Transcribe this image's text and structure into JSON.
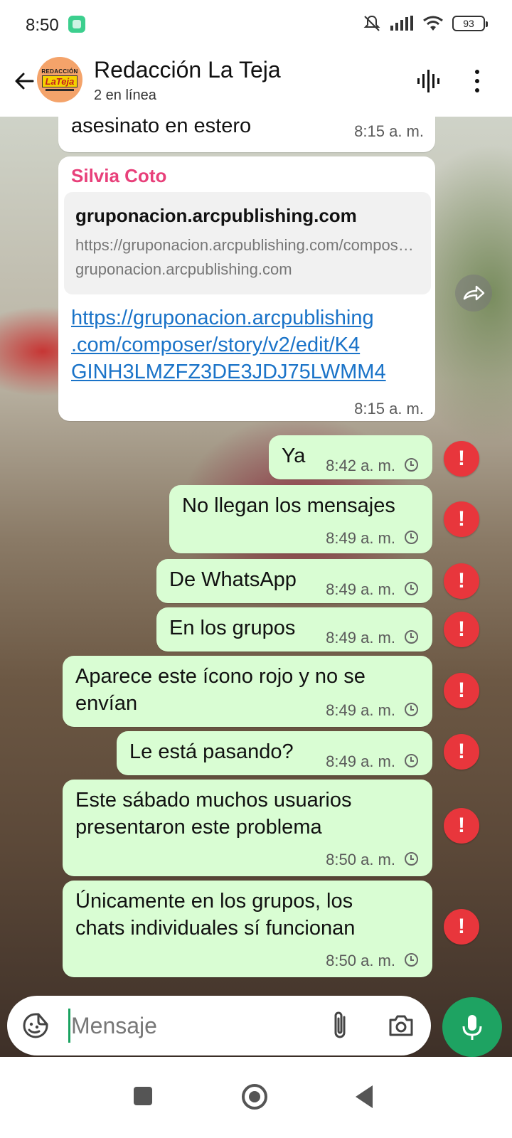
{
  "status_bar": {
    "time": "8:50",
    "battery": "93",
    "icons": [
      "app-notification-icon",
      "bell-muted-icon",
      "signal-icon",
      "wifi-icon",
      "battery-icon"
    ]
  },
  "header": {
    "title": "Redacción La Teja",
    "subtitle": "2 en línea",
    "avatar": {
      "line1": "REDACCIÓN",
      "logo": "LaTeja"
    }
  },
  "messages": {
    "m0": {
      "text": "asesinato en estero",
      "time": "8:15 a. m."
    },
    "m1": {
      "sender": "Silvia Coto",
      "preview_title": "gruponacion.arcpublishing.com",
      "preview_url": "https://gruponacion.arcpublishing.com/composer/story/v2/edit/K4GINH3LMZFZ3DE3JDJ75LWMM4",
      "preview_domain": "gruponacion.arcpublishing.com",
      "link_lines": [
        "https://gruponacion.arcpublishing",
        ".com/composer/story/v2/edit/K4",
        "GINH3LMZFZ3DE3JDJ75LWMM4"
      ],
      "time": "8:15 a. m."
    },
    "m2": {
      "text": "Ya",
      "time": "8:42 a. m."
    },
    "m3": {
      "text": "No llegan los mensajes",
      "time": "8:49 a. m."
    },
    "m4": {
      "text": "De WhatsApp",
      "time": "8:49 a. m."
    },
    "m5": {
      "text": "En los grupos",
      "time": "8:49 a. m."
    },
    "m6": {
      "lines": [
        "Aparece este ícono rojo y no se",
        "envían"
      ],
      "time": "8:49 a. m."
    },
    "m7": {
      "text": "Le está pasando?",
      "time": "8:49 a. m."
    },
    "m8": {
      "lines": [
        "Este sábado muchos usuarios",
        "presentaron este problema"
      ],
      "time": "8:50 a. m."
    },
    "m9": {
      "lines": [
        "Únicamente en los grupos, los",
        "chats individuales sí funcionan"
      ],
      "time": "8:50 a. m."
    },
    "error_glyph": "!"
  },
  "input": {
    "placeholder": "Mensaje",
    "value": ""
  },
  "colors": {
    "outgoing_bubble": "#d9fdd3",
    "incoming_bubble": "#ffffff",
    "error_badge": "#e8363c",
    "sender_name": "#e8407a",
    "link": "#1a73c8",
    "mic_button": "#1ea362"
  }
}
